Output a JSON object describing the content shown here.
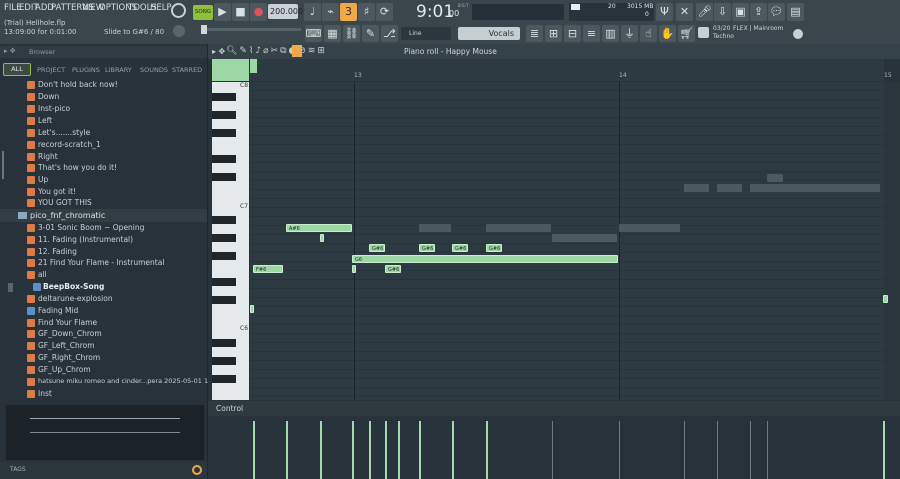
{
  "menu": [
    "FILE",
    "EDIT",
    "ADD",
    "PATTERNS",
    "VIEW",
    "OPTIONS",
    "TOOLS",
    "HELP"
  ],
  "transport": {
    "mode": "SONG",
    "tempo": "200.000",
    "time": "9:01",
    "time_sub": "00",
    "bst": "B:S:T"
  },
  "status": {
    "project": "(Trial) Hellhole.flp",
    "timecode": "13:09:00 for 0:01:00",
    "hint": "Slide to G#6 / 80"
  },
  "cpu": {
    "value": "20",
    "mem": "3015 MB",
    "poly": "0"
  },
  "snap": "Line",
  "channel_selector": "Vocals",
  "news": {
    "line1": "03/20",
    "line2": "FLEX | Mainroom",
    "line3": "Techno"
  },
  "browser": {
    "title": "Browser",
    "tabs": [
      "ALL",
      "PROJECT",
      "PLUGINS",
      "LIBRARY",
      "SOUNDS",
      "STARRED"
    ],
    "footer": "TAGS",
    "items": [
      "Don't hold back now!",
      "Down",
      "Inst-pico",
      "Left",
      "Let's.......style",
      "record-scratch_1",
      "Right",
      "That's how you do it!",
      "Up",
      "You got it!",
      "YOU GOT THIS"
    ],
    "folder": "pico_fnf_chromatic",
    "items2": [
      "3-01 Sonic Boom ~ Opening",
      "11. Fading (Instrumental)",
      "12. Fading",
      "21 Find Your Flame - Instrumental",
      "all",
      "BeepBox-Song",
      "deltarune-explosion",
      "Fading Mid",
      "Find Your Flame",
      "GF_Down_Chrom",
      "GF_Left_Chrom",
      "GF_Right_Chrom",
      "GF_Up_Chrom",
      "hatsune miku romeo and cinder...pera 2025-05-01 13-26-57",
      "Inst"
    ]
  },
  "pianoroll": {
    "title": "Piano roll - Happy Mouse",
    "bar_13": "13",
    "bar_14": "14",
    "bar_15": "15",
    "keys": [
      "C8",
      "C7",
      "C6"
    ],
    "control": "Control",
    "notes": {
      "a6": "A#6",
      "g6a": "G#6",
      "g6b": "G#6",
      "g6c": "G#6",
      "g6d": "G#6",
      "g6e": "G#6",
      "g6": "G6",
      "f6": "F#6"
    }
  },
  "colors": {
    "accent": "#f0a848",
    "note": "#9ed7a6",
    "bg": "#27323a"
  }
}
